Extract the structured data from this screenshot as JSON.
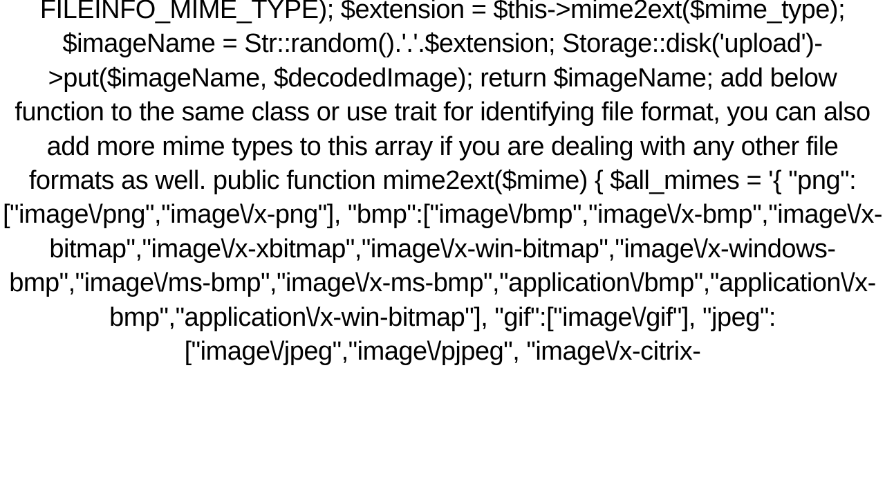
{
  "content": {
    "text": "FILEINFO_MIME_TYPE); $extension = $this->mime2ext($mime_type);  $imageName = Str::random().'.'.$extension; Storage::disk('upload')->put($imageName, $decodedImage); return $imageName;   add below function to the same class or use trait for identifying file format, you can also add more mime types to this array if you are dealing with any other file formats as well.  public function mime2ext($mime) {     $all_mimes = '{     \"png\":[\"image\\/png\",\"image\\/x-png\"],     \"bmp\":[\"image\\/bmp\",\"image\\/x-bmp\",\"image\\/x-bitmap\",\"image\\/x-xbitmap\",\"image\\/x-win-bitmap\",\"image\\/x-windows-bmp\",\"image\\/ms-bmp\",\"image\\/x-ms-bmp\",\"application\\/bmp\",\"application\\/x-bmp\",\"application\\/x-win-bitmap\"],     \"gif\":[\"image\\/gif\"],     \"jpeg\":[\"image\\/jpeg\",\"image\\/pjpeg\", \"image\\/x-citrix-"
  }
}
